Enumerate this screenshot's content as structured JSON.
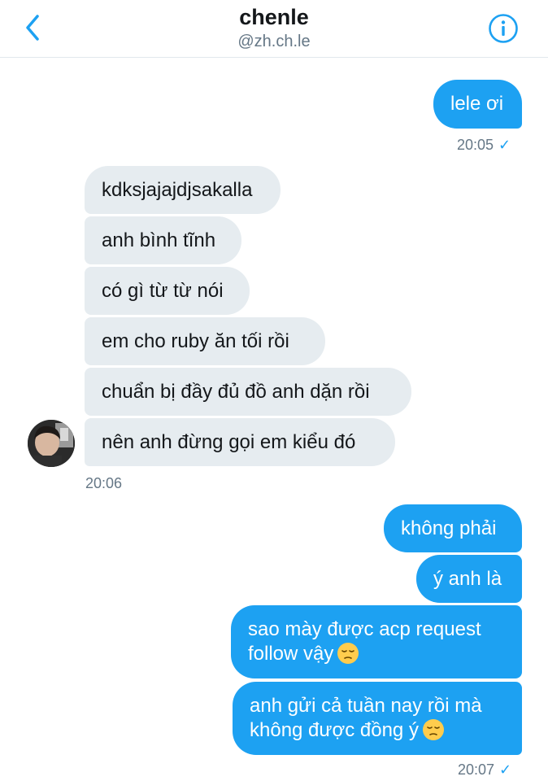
{
  "header": {
    "title": "chenle",
    "handle": "@zh.ch.le",
    "back_icon": "chevron-left-icon",
    "info_icon": "info-icon",
    "accent": "#1da1f2"
  },
  "messages": {
    "m1": "lele ơi",
    "t1": "20:05",
    "r1": "kdksjajajdjsakalla",
    "r2": "anh bình tĩnh",
    "r3": "có gì từ từ nói",
    "r4": "em cho ruby ăn tối rồi",
    "r5": "chuẩn bị đầy đủ đồ anh dặn rồi",
    "r6": "nên anh đừng gọi em kiểu đó",
    "t2": "20:06",
    "m2": "không phải",
    "m3": "ý anh là",
    "m4_line1": "sao mày được acp request",
    "m4_line2": "follow vậy",
    "m5_line1": "anh gửi cả tuần nay rồi mà",
    "m5_line2": "không được đồng ý",
    "t3": "20:07",
    "emoji_icon": "pensive-face-icon"
  },
  "colors": {
    "outgoing_bubble": "#1da1f2",
    "incoming_bubble": "#e6ecf0"
  }
}
